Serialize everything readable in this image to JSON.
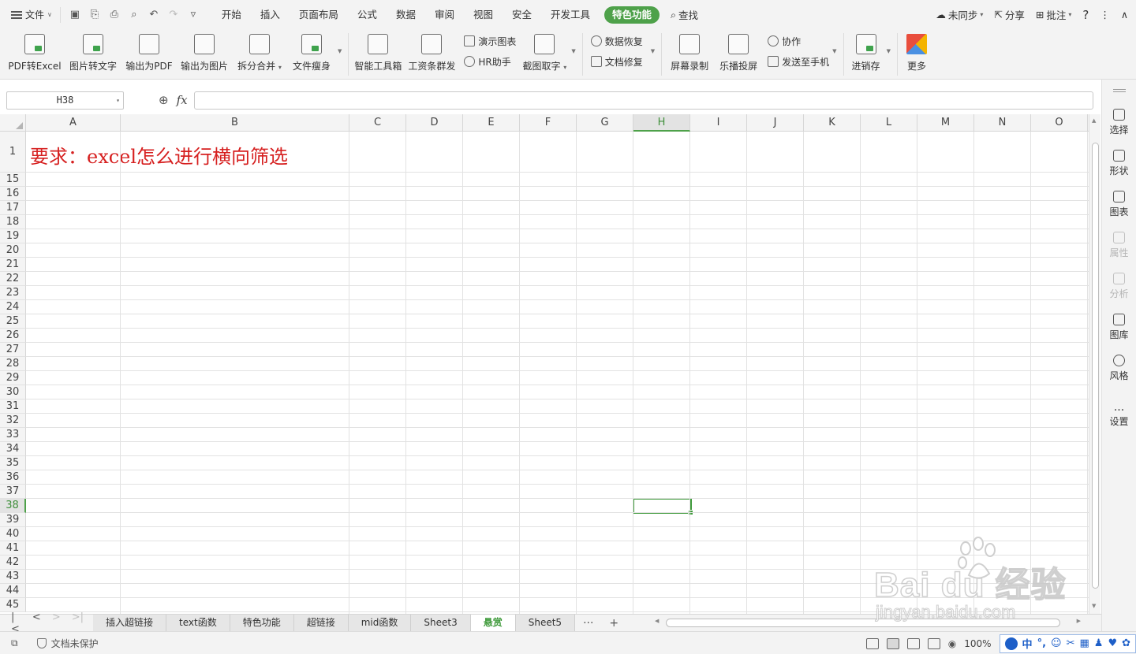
{
  "menu": {
    "file_label": "文件",
    "tabs": [
      "开始",
      "插入",
      "页面布局",
      "公式",
      "数据",
      "审阅",
      "视图",
      "安全",
      "开发工具",
      "特色功能"
    ],
    "active_tab": "特色功能",
    "find_label": "查找",
    "right": {
      "sync": "未同步",
      "share": "分享",
      "comment": "批注",
      "help": "?"
    }
  },
  "ribbon": {
    "group1": [
      "PDF转Excel",
      "图片转文字",
      "输出为PDF",
      "输出为图片",
      "拆分合并",
      "文件瘦身"
    ],
    "group2_big": [
      "智能工具箱",
      "工资条群发"
    ],
    "group2_small": [
      "演示图表",
      "HR助手"
    ],
    "group2_capture": "截图取字",
    "group3_small": [
      "数据恢复",
      "文档修复"
    ],
    "group4_big": [
      "屏幕录制",
      "乐播投屏"
    ],
    "group4_small": [
      "协作",
      "发送至手机"
    ],
    "group5_big": [
      "进销存",
      "更多"
    ]
  },
  "formula": {
    "name_box": "H38",
    "fx": "fx",
    "value": ""
  },
  "grid": {
    "columns": [
      "A",
      "B",
      "C",
      "D",
      "E",
      "F",
      "G",
      "H",
      "I",
      "J",
      "K",
      "L",
      "M",
      "N",
      "O"
    ],
    "selected_column": "H",
    "rows": [
      "1",
      "15",
      "16",
      "17",
      "18",
      "19",
      "20",
      "21",
      "22",
      "23",
      "24",
      "25",
      "26",
      "27",
      "28",
      "29",
      "30",
      "31",
      "32",
      "33",
      "34",
      "35",
      "36",
      "37",
      "38",
      "39",
      "40",
      "41",
      "42",
      "43",
      "44",
      "45"
    ],
    "selected_row": "38",
    "cell_A1": "要求：excel怎么进行横向筛选"
  },
  "sidebar": [
    "选择",
    "形状",
    "图表",
    "属性",
    "分析",
    "图库",
    "风格",
    "设置"
  ],
  "sheets": [
    "插入超链接",
    "text函数",
    "特色功能",
    "超链接",
    "mid函数",
    "Sheet3",
    "悬赏",
    "Sheet5"
  ],
  "active_sheet": "悬赏",
  "status": {
    "protect": "文档未保护",
    "zoom": "100%",
    "ime": "中"
  },
  "watermark": {
    "brand": "Bai du 经验",
    "url": "jingyan.baidu.com"
  },
  "colors": {
    "accent": "#4ea14a",
    "cell_text": "#d62020"
  }
}
